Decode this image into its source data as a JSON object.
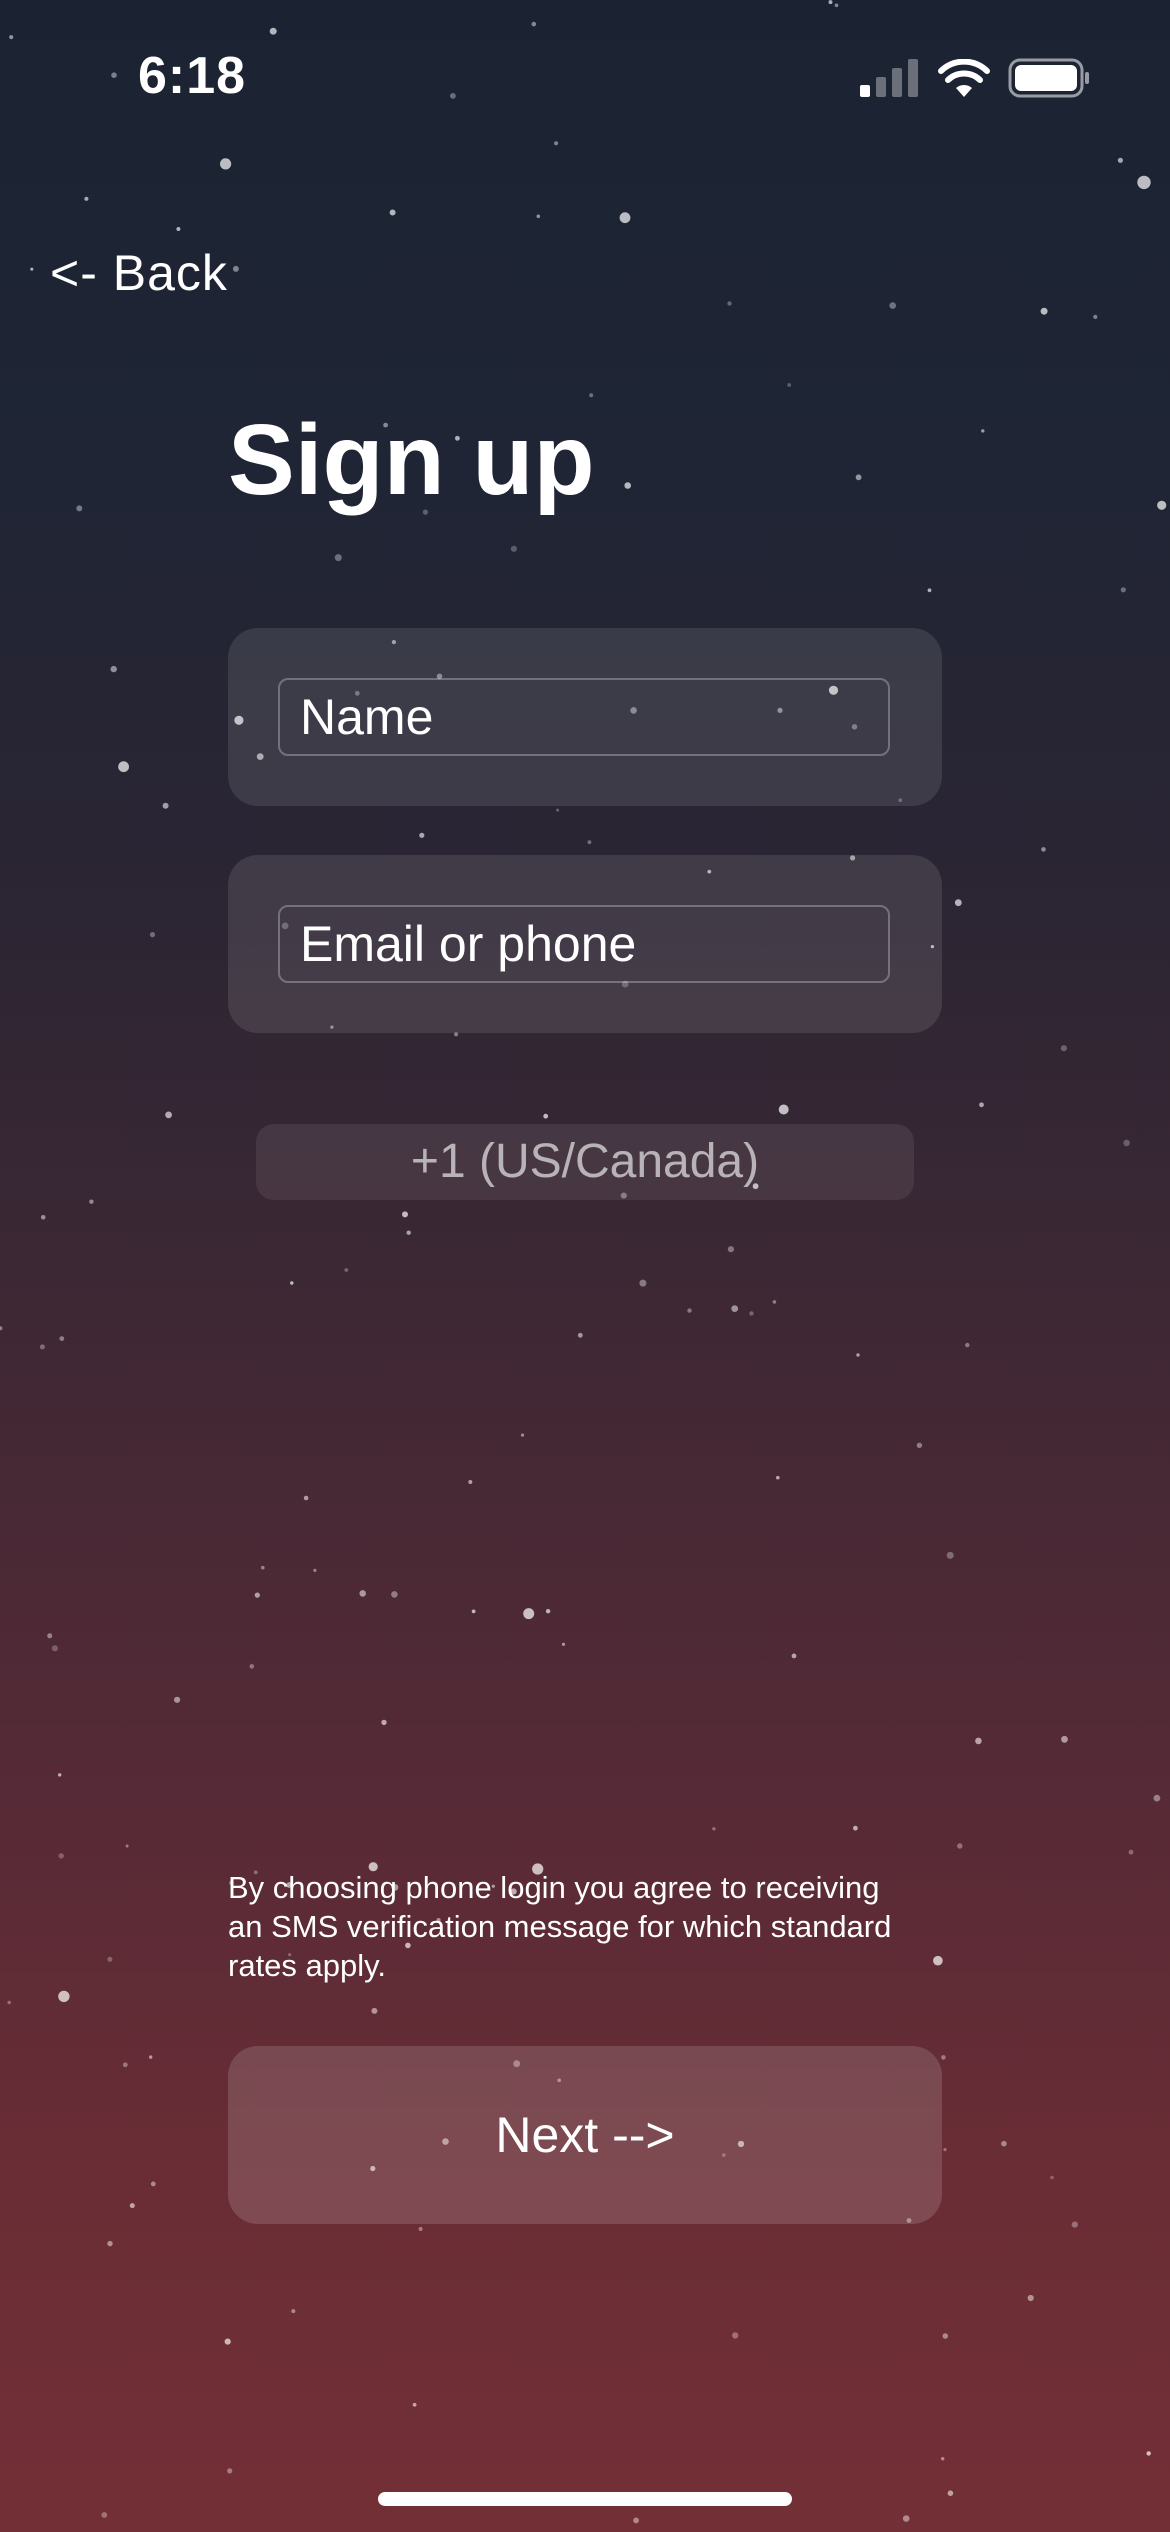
{
  "status_bar": {
    "time": "6:18"
  },
  "nav": {
    "back_label": "<- Back"
  },
  "page": {
    "title": "Sign up"
  },
  "form": {
    "name_placeholder": "Name",
    "contact_placeholder": "Email or phone",
    "country_code": "+1 (US/Canada)"
  },
  "footer": {
    "disclaimer": "By choosing phone login you agree to receiving an SMS verification message for which standard rates apply.",
    "next_label": "Next -->"
  },
  "colors": {
    "background_top": "#1b2333",
    "background_bottom": "#732f36",
    "text": "#ffffff"
  }
}
